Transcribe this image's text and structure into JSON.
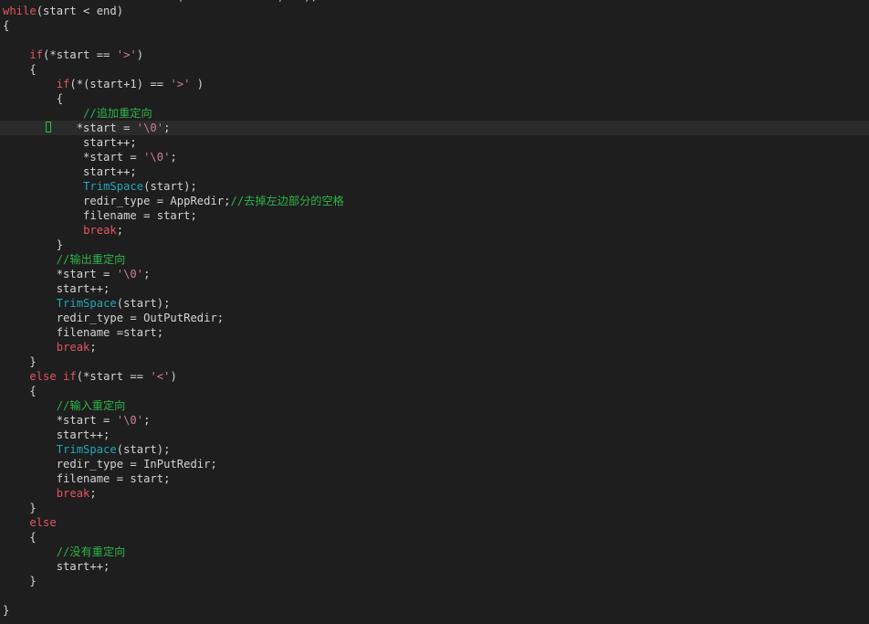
{
  "editor": {
    "colors": {
      "background": "#1e1e1e",
      "current_line": "#2b2b2b",
      "keyword": "#e05561",
      "plain": "#d4d4d4",
      "string": "#ce7ca0",
      "comment": "#2fb34a",
      "function": "#1fa8b8",
      "cursor": "#22cc22"
    },
    "current_line_index": 9,
    "lines": [
      [
        {
          "t": "plain",
          "v": "                          (              )   );"
        }
      ],
      [
        {
          "t": "keyword",
          "v": "while"
        },
        {
          "t": "plain",
          "v": "(start < end)"
        }
      ],
      [
        {
          "t": "plain",
          "v": "{"
        }
      ],
      [],
      [
        {
          "t": "plain",
          "v": "    "
        },
        {
          "t": "keyword",
          "v": "if"
        },
        {
          "t": "plain",
          "v": "(*start == "
        },
        {
          "t": "string",
          "v": "'>'"
        },
        {
          "t": "plain",
          "v": ")"
        }
      ],
      [
        {
          "t": "plain",
          "v": "    {"
        }
      ],
      [
        {
          "t": "plain",
          "v": "        "
        },
        {
          "t": "keyword",
          "v": "if"
        },
        {
          "t": "plain",
          "v": "(*(start+1) == "
        },
        {
          "t": "string",
          "v": "'>'"
        },
        {
          "t": "plain",
          "v": " )"
        }
      ],
      [
        {
          "t": "plain",
          "v": "        {"
        }
      ],
      [
        {
          "t": "plain",
          "v": "            "
        },
        {
          "t": "comment",
          "v": "//追加重定向"
        }
      ],
      [
        {
          "t": "plain",
          "v": "           *start = "
        },
        {
          "t": "string",
          "v": "'\\0'"
        },
        {
          "t": "plain",
          "v": ";"
        }
      ],
      [
        {
          "t": "plain",
          "v": "            start++;"
        }
      ],
      [
        {
          "t": "plain",
          "v": "            *start = "
        },
        {
          "t": "string",
          "v": "'\\0'"
        },
        {
          "t": "plain",
          "v": ";"
        }
      ],
      [
        {
          "t": "plain",
          "v": "            start++;"
        }
      ],
      [
        {
          "t": "plain",
          "v": "            "
        },
        {
          "t": "func",
          "v": "TrimSpace"
        },
        {
          "t": "plain",
          "v": "(start);"
        }
      ],
      [
        {
          "t": "plain",
          "v": "            redir_type = AppRedir;"
        },
        {
          "t": "comment",
          "v": "//去掉左边部分的空格"
        }
      ],
      [
        {
          "t": "plain",
          "v": "            filename = start;"
        }
      ],
      [
        {
          "t": "plain",
          "v": "            "
        },
        {
          "t": "keyword",
          "v": "break"
        },
        {
          "t": "plain",
          "v": ";"
        }
      ],
      [
        {
          "t": "plain",
          "v": "        }"
        }
      ],
      [
        {
          "t": "plain",
          "v": "        "
        },
        {
          "t": "comment",
          "v": "//输出重定向"
        }
      ],
      [
        {
          "t": "plain",
          "v": "        *start = "
        },
        {
          "t": "string",
          "v": "'\\0'"
        },
        {
          "t": "plain",
          "v": ";"
        }
      ],
      [
        {
          "t": "plain",
          "v": "        start++;"
        }
      ],
      [
        {
          "t": "plain",
          "v": "        "
        },
        {
          "t": "func",
          "v": "TrimSpace"
        },
        {
          "t": "plain",
          "v": "(start);"
        }
      ],
      [
        {
          "t": "plain",
          "v": "        redir_type = OutPutRedir;"
        }
      ],
      [
        {
          "t": "plain",
          "v": "        filename =start;"
        }
      ],
      [
        {
          "t": "plain",
          "v": "        "
        },
        {
          "t": "keyword",
          "v": "break"
        },
        {
          "t": "plain",
          "v": ";"
        }
      ],
      [
        {
          "t": "plain",
          "v": "    }"
        }
      ],
      [
        {
          "t": "plain",
          "v": "    "
        },
        {
          "t": "keyword",
          "v": "else if"
        },
        {
          "t": "plain",
          "v": "(*start == "
        },
        {
          "t": "string",
          "v": "'<'"
        },
        {
          "t": "plain",
          "v": ")"
        }
      ],
      [
        {
          "t": "plain",
          "v": "    {"
        }
      ],
      [
        {
          "t": "plain",
          "v": "        "
        },
        {
          "t": "comment",
          "v": "//输入重定向"
        }
      ],
      [
        {
          "t": "plain",
          "v": "        *start = "
        },
        {
          "t": "string",
          "v": "'\\0'"
        },
        {
          "t": "plain",
          "v": ";"
        }
      ],
      [
        {
          "t": "plain",
          "v": "        start++;"
        }
      ],
      [
        {
          "t": "plain",
          "v": "        "
        },
        {
          "t": "func",
          "v": "TrimSpace"
        },
        {
          "t": "plain",
          "v": "(start);"
        }
      ],
      [
        {
          "t": "plain",
          "v": "        redir_type = InPutRedir;"
        }
      ],
      [
        {
          "t": "plain",
          "v": "        filename = start;"
        }
      ],
      [
        {
          "t": "plain",
          "v": "        "
        },
        {
          "t": "keyword",
          "v": "break"
        },
        {
          "t": "plain",
          "v": ";"
        }
      ],
      [
        {
          "t": "plain",
          "v": "    }"
        }
      ],
      [
        {
          "t": "plain",
          "v": "    "
        },
        {
          "t": "keyword",
          "v": "else"
        }
      ],
      [
        {
          "t": "plain",
          "v": "    {"
        }
      ],
      [
        {
          "t": "plain",
          "v": "        "
        },
        {
          "t": "comment",
          "v": "//没有重定向"
        }
      ],
      [
        {
          "t": "plain",
          "v": "        start++;"
        }
      ],
      [
        {
          "t": "plain",
          "v": "    }"
        }
      ],
      [],
      [
        {
          "t": "plain",
          "v": "}"
        }
      ],
      []
    ]
  }
}
